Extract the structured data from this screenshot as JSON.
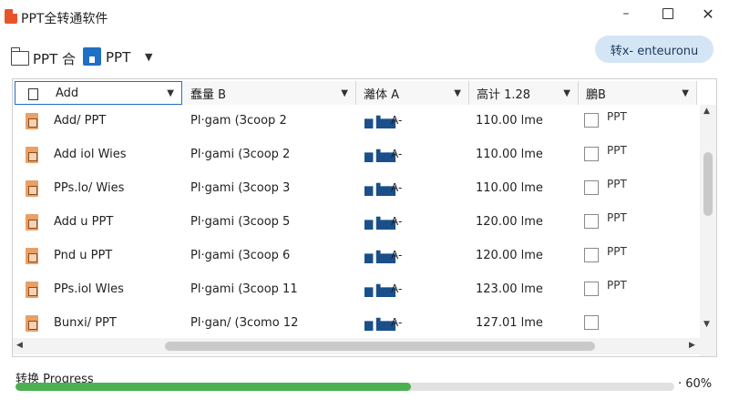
{
  "window": {
    "title": "PPT全转通软件",
    "minimize": "–",
    "maximize": "",
    "close": "✕"
  },
  "toolbar": {
    "left_label": "PPT 合",
    "right_label": "PPT",
    "caret": "▼",
    "pill_button": "转x- enteuronu"
  },
  "columns": [
    {
      "label": "Add",
      "sort_icon": "▼"
    },
    {
      "label": "蠢量 B",
      "sort_icon": "▼"
    },
    {
      "label": "灕体 A",
      "sort_icon": "▼"
    },
    {
      "label": "高计 1.28",
      "sort_icon": "▼"
    },
    {
      "label": "鵬B",
      "sort_icon": "▼"
    }
  ],
  "rows": [
    {
      "name": "Add/ PPT",
      "col2": "Pl·gam (Зcoop 2",
      "col3_icon": "▆▐▆▆",
      "col3": "A-",
      "col4": "110.00 lme",
      "checked": false,
      "col5": "PPT"
    },
    {
      "name": "Add iol Wies",
      "col2": "Pl·gami (Зcoop 2",
      "col3_icon": "▆▐▆▆",
      "col3": "A-",
      "col4": "110.00 lme",
      "checked": false,
      "col5": "PPT"
    },
    {
      "name": "PPs.lo/ Wies",
      "col2": "Pl·gami (Зcoop 3",
      "col3_icon": "▆▐▆▆",
      "col3": "A-",
      "col4": "110.00 lme",
      "checked": false,
      "col5": "PPT"
    },
    {
      "name": "Add u PPT",
      "col2": "Pl·gami (Зcoop 5",
      "col3_icon": "▆▐▆▆",
      "col3": "A-",
      "col4": "120.00 lme",
      "checked": false,
      "col5": "PPT"
    },
    {
      "name": "Pnd u PPT",
      "col2": "Pl·gami (Зcoop 6",
      "col3_icon": "▆▐▆▆",
      "col3": "A-",
      "col4": "120.00 lme",
      "checked": false,
      "col5": "PPT"
    },
    {
      "name": "PPs.iol Wles",
      "col2": "Pl·gami (Зcoop 11",
      "col3_icon": "▆▐▆▆",
      "col3": "A-",
      "col4": "123.00 lme",
      "checked": false,
      "col5": "PPT"
    },
    {
      "name": "Bunxi/ PPT",
      "col2": "Pl·gan/ (Зcomo 12",
      "col3_icon": "▆▐▆▆",
      "col3": "A-",
      "col4": "127.01 lme",
      "checked": false,
      "col5": ""
    }
  ],
  "scroll": {
    "up": "▲",
    "down": "▼",
    "left": "◀",
    "right": "▶"
  },
  "progress": {
    "label": "转换 Progress",
    "value_percent": 60,
    "text": "· 60%",
    "fill_color": "#4caf50"
  },
  "colors": {
    "accent": "#1f6fc4",
    "pill": "#d4e5f5",
    "file_icon": "#e9a066",
    "app_icon": "#e8542a"
  }
}
